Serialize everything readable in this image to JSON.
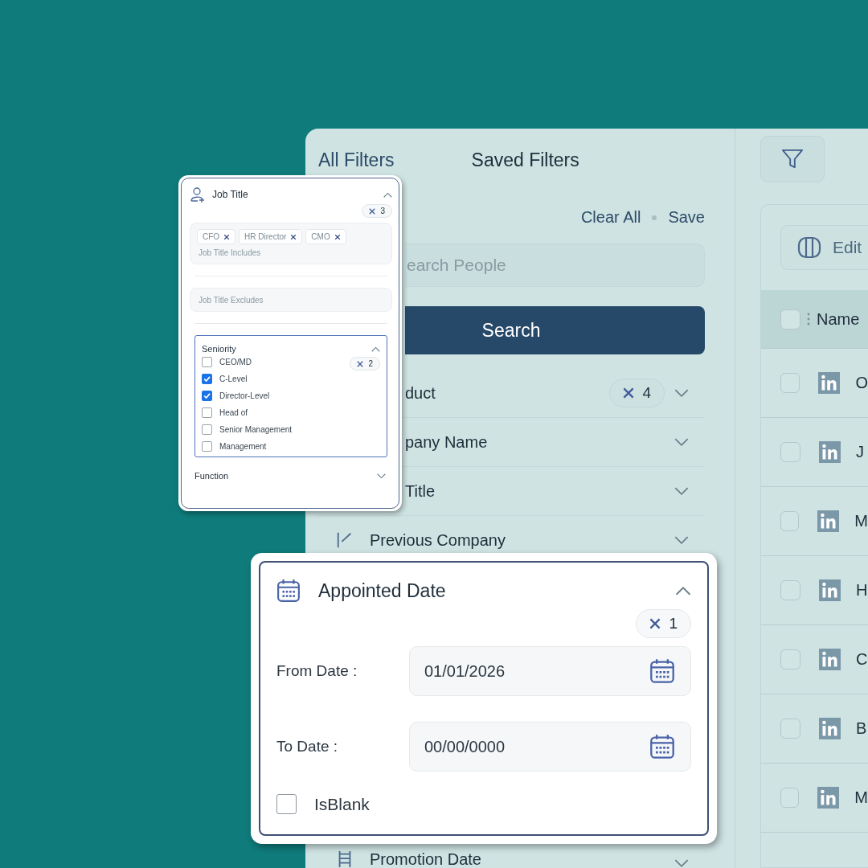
{
  "filter_panel": {
    "tabs": [
      {
        "label": "All Filters",
        "selected": true
      },
      {
        "label": "Saved Filters",
        "selected": false
      }
    ],
    "actions": [
      "Clear All",
      "Save"
    ],
    "search": {
      "placeholder": "earch People"
    },
    "search_button": "Search",
    "filters": [
      {
        "label": "duct",
        "count": "4",
        "expanded": false
      },
      {
        "label": "pany Name",
        "expanded": false
      },
      {
        "label": "Title",
        "expanded": false
      },
      {
        "label": "Previous Company",
        "expanded": false
      },
      {
        "label": "Promotion Date",
        "expanded": false
      }
    ]
  },
  "results": {
    "edit_button": "Edit",
    "header": {
      "checked": false,
      "column": "Name"
    },
    "rows": [
      {
        "checked": false,
        "name": "O"
      },
      {
        "checked": false,
        "name": "J"
      },
      {
        "checked": false,
        "name": "M"
      },
      {
        "checked": false,
        "name": "H"
      },
      {
        "checked": false,
        "name": "C"
      },
      {
        "checked": false,
        "name": "B"
      },
      {
        "checked": false,
        "name": "M"
      }
    ]
  },
  "job_title_card": {
    "title": "Job Title",
    "expanded": true,
    "count": "3",
    "includes": {
      "tags": [
        "CFO",
        "HR Director",
        "CMO"
      ],
      "placeholder": "Job Title Includes"
    },
    "excludes": {
      "placeholder": "Job Title Excludes"
    },
    "seniority": {
      "title": "Seniority",
      "expanded": true,
      "count": "2",
      "options": [
        {
          "label": "CEO/MD",
          "checked": false
        },
        {
          "label": "C-Level",
          "checked": true
        },
        {
          "label": "Director-Level",
          "checked": true
        },
        {
          "label": "Head of",
          "checked": false
        },
        {
          "label": "Senior Management",
          "checked": false
        },
        {
          "label": "Management",
          "checked": false
        }
      ]
    },
    "function": {
      "title": "Function",
      "expanded": false
    }
  },
  "appointed_date_card": {
    "title": "Appointed Date",
    "expanded": true,
    "count": "1",
    "from": {
      "label": "From Date :",
      "value": "01/01/2026"
    },
    "to": {
      "label": "To Date :",
      "value": "00/00/0000"
    },
    "is_blank": {
      "label": "IsBlank",
      "checked": false
    }
  }
}
